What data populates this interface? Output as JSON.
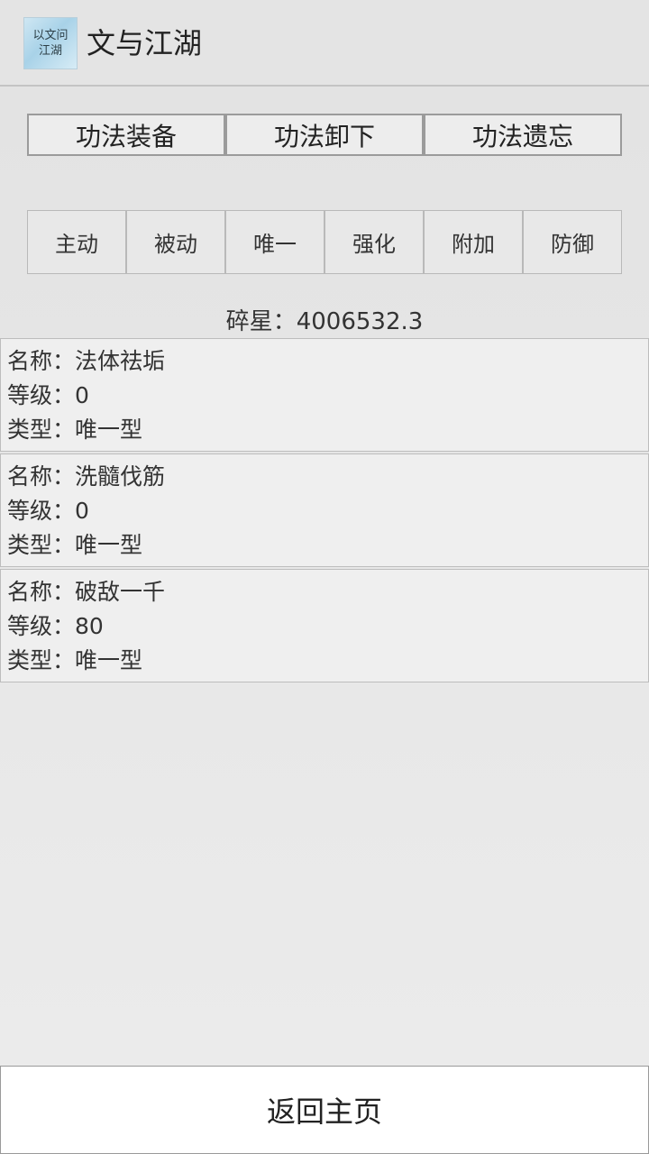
{
  "app": {
    "title": "文与江湖",
    "icon_text": [
      "以文问",
      "江湖"
    ]
  },
  "actions": [
    {
      "label": "功法装备"
    },
    {
      "label": "功法卸下"
    },
    {
      "label": "功法遗忘"
    }
  ],
  "tabs": [
    {
      "label": "主动"
    },
    {
      "label": "被动"
    },
    {
      "label": "唯一"
    },
    {
      "label": "强化"
    },
    {
      "label": "附加"
    },
    {
      "label": "防御"
    }
  ],
  "currency": {
    "label": "碎星",
    "separator": "：",
    "value": "4006532.3"
  },
  "skills": [
    {
      "name_line": "名称：法体祛垢",
      "level_line": "等级：0",
      "type_line": "类型：唯一型"
    },
    {
      "name_line": "名称：洗髓伐筋",
      "level_line": "等级：0",
      "type_line": "类型：唯一型"
    },
    {
      "name_line": "名称：破敌一千",
      "level_line": "等级：80",
      "type_line": "类型：唯一型"
    }
  ],
  "footer": {
    "back_label": "返回主页"
  }
}
